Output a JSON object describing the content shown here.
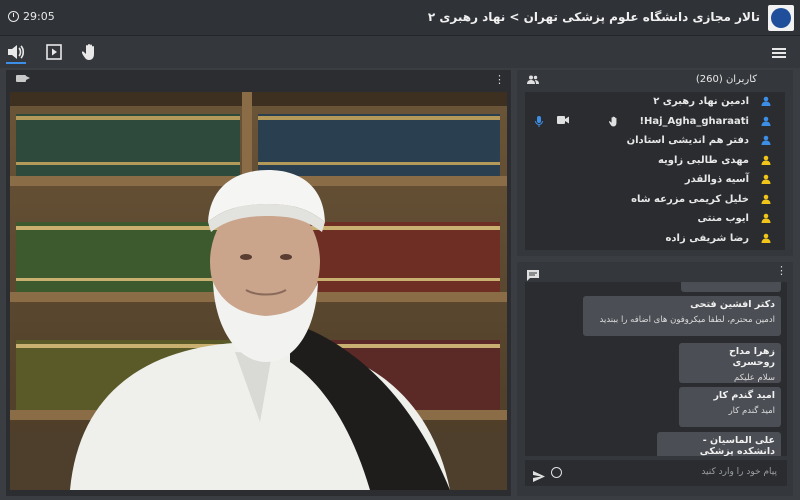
{
  "header": {
    "title": "تالار مجازی دانشگاه علوم پزشکی تهران > نهاد رهبری ۲",
    "clock": "29:05"
  },
  "users": {
    "title": "کاربران (260)",
    "items": [
      {
        "name": "ادمین نهاد رهبری ۲",
        "color": "#3c8ee6"
      },
      {
        "name": "Haj_Agha_gharaati!",
        "color": "#3c8ee6"
      },
      {
        "name": "دفتر هم اندیشی استادان",
        "color": "#3c8ee6"
      },
      {
        "name": "مهدی طالبی زاویه",
        "color": "#f0c419"
      },
      {
        "name": "آسیه ذوالقدر",
        "color": "#f0c419"
      },
      {
        "name": "خلیل کریمی مزرعه شاه",
        "color": "#f0c419"
      },
      {
        "name": "ایوب منتی",
        "color": "#f0c419"
      },
      {
        "name": "رضا شریفی زاده",
        "color": "#f0c419"
      }
    ]
  },
  "chat": {
    "messages": [
      {
        "author": "دکتر افشین فتحی",
        "text": "ادمین محترم، لطفا میکروفون های اضافه را ببندید"
      },
      {
        "author": "زهرا مداح روحسری",
        "text": "سلام علیکم"
      },
      {
        "author": "امید گندم کار",
        "text": "امید گندم کار"
      },
      {
        "author": "علی الماسیان - دانشکده پزشکی",
        "text": ""
      }
    ],
    "input_placeholder": "پیام خود را وارد کنید"
  },
  "colors": {
    "accent": "#3c8ee6",
    "viewer": "#f0c419"
  }
}
